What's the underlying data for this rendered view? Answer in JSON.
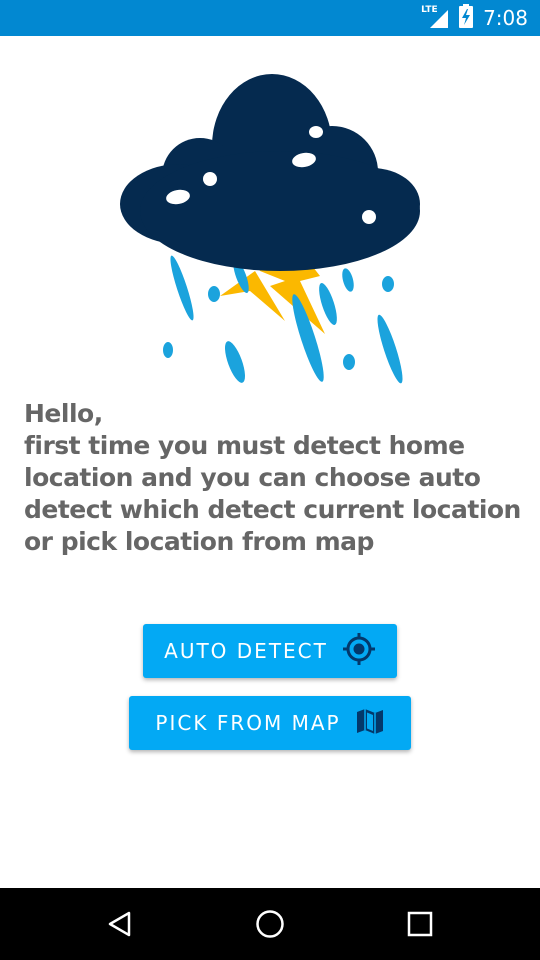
{
  "status_bar": {
    "network_label": "LTE",
    "time": "7:08",
    "icons": [
      "signal-icon",
      "battery-charging-icon"
    ],
    "background_color": "#0288d1"
  },
  "illustration": {
    "icon": "storm-cloud-icon",
    "colors": {
      "cloud": "#052a4f",
      "rain": "#1ba3dd",
      "lightning": "#fbb800"
    }
  },
  "message": {
    "text": "Hello,\nfirst time you must detect home location and you can choose auto detect which detect current location or pick location from map"
  },
  "buttons": {
    "auto_detect": {
      "label": "AUTO DETECT",
      "icon": "gps-target-icon"
    },
    "pick_from_map": {
      "label": "PICK FROM MAP",
      "icon": "map-icon"
    },
    "color": "#03a9f4"
  },
  "nav_bar": {
    "icons": [
      "back-icon",
      "home-icon",
      "recents-icon"
    ]
  }
}
